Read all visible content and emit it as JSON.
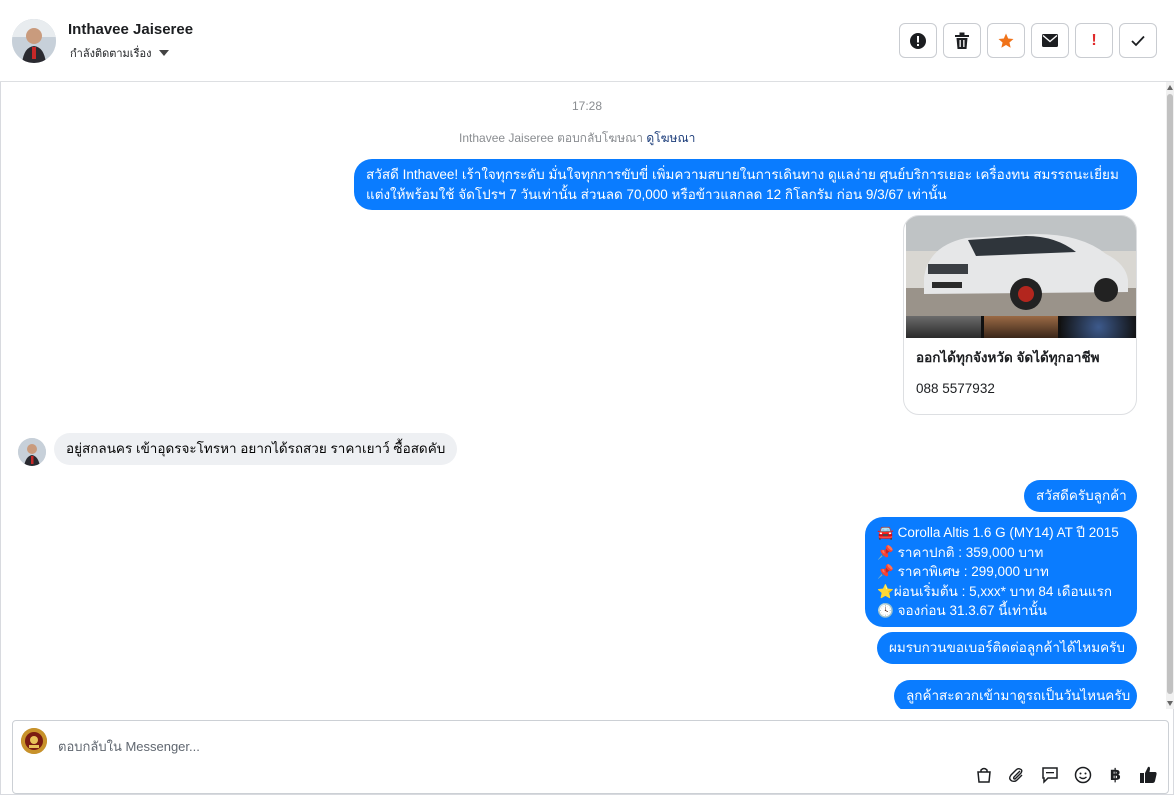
{
  "contact": {
    "name": "Inthavee Jaiseree",
    "status_label": "กำลังติดตามเรื่อง"
  },
  "header_actions": [
    {
      "icon": "spam-icon",
      "label": ""
    },
    {
      "icon": "trash-icon",
      "label": ""
    },
    {
      "icon": "star-icon",
      "label": "",
      "color": "#f0731a"
    },
    {
      "icon": "envelope-icon",
      "label": ""
    },
    {
      "icon": "follow-up-icon",
      "label": "!",
      "color": "#e02b2b"
    },
    {
      "icon": "check-icon",
      "label": ""
    }
  ],
  "conversation": {
    "timestamp": "17:28",
    "replied_prefix": "Inthavee Jaiseree ตอบกลับโฆษณา",
    "view_ad_link": "ดูโฆษณา",
    "ad_message_line1": "สวัสดี Inthavee! เร้าใจทุกระดับ มั่นใจทุกการขับขี่ เพิ่มความสบายในการเดินทาง ดูแลง่าย ศูนย์บริการเยอะ เครื่องทน สมรรถนะเยี่ยม",
    "ad_message_line2": "แต่งให้พร้อมใช้ จัดโปรฯ 7 วันเท่านั้น ส่วนลด 70,000 หรือข้าวแลกลด 12 กิโลกรัม ก่อน 9/3/67 เท่านั้น",
    "ad_card": {
      "title": "ออกได้ทุกจังหวัด จัดได้ทุกอาชีพ",
      "phone": "088 5577932"
    },
    "customer_message": "อยู่สกลนคร เข้าอุดรจะโทรหา อยากได้รถสวย ราคาเยาว์ ซื้อสดคับ",
    "reply_greeting": "สวัสดีครับลูกค้า",
    "offer_lines": [
      {
        "emoji": "🚘",
        "text": "Corolla Altis 1.6 G (MY14) AT ปี 2015"
      },
      {
        "emoji": "📌",
        "text": "ราคาปกติ : 359,000 บาท"
      },
      {
        "emoji": "📌",
        "text": "ราคาพิเศษ : 299,000 บาท"
      },
      {
        "emoji": "⭐",
        "text": "ผ่อนเริ่มต้น : 5,xxx* บาท 84 เดือนแรก"
      },
      {
        "emoji": "🕓",
        "text": "จองก่อน 31.3.67 นี้เท่านั้น"
      }
    ],
    "ask_phone": "ผมรบกวนขอเบอร์ติดต่อลูกค้าได้ไหมครับ",
    "ask_day": "ลูกค้าสะดวกเข้ามาดูรถเป็นวันไหนครับ"
  },
  "composer": {
    "placeholder": "ตอบกลับใน Messenger...",
    "tools": [
      "shop-icon",
      "attach-icon",
      "saved-reply-icon",
      "emoji-icon",
      "baht-icon",
      "thumbs-up-icon"
    ]
  },
  "colors": {
    "outgoing_bubble": "#0a7cff",
    "incoming_bubble": "#eef0f3"
  }
}
